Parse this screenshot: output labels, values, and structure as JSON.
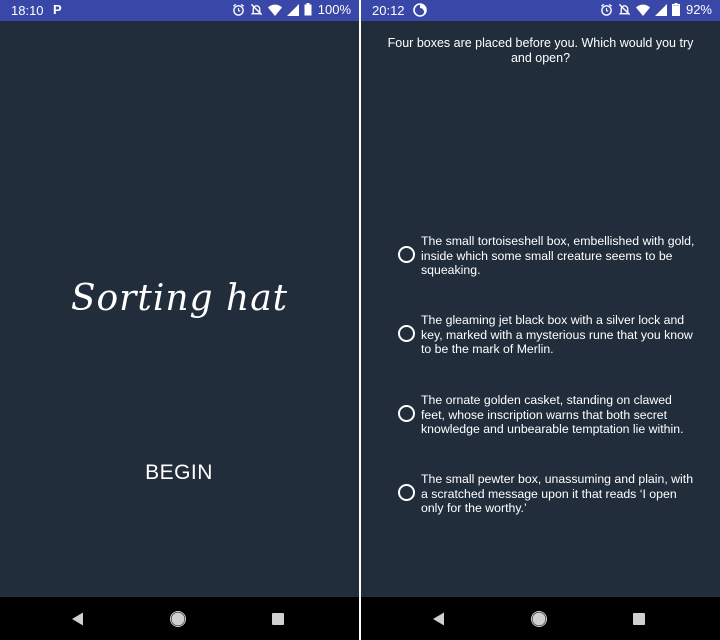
{
  "left_screen": {
    "status_bar": {
      "time": "18:10",
      "notification_icon": "parking-p-icon",
      "battery": "100%"
    },
    "title": "Sorting hat",
    "begin_label": "BEGIN"
  },
  "right_screen": {
    "status_bar": {
      "time": "20:12",
      "notification_icon": "circle-app-icon",
      "battery": "92%"
    },
    "question": "Four boxes are placed before you. Which would you try and open?",
    "options": [
      {
        "label": "The small tortoiseshell box, embellished with gold, inside which some small creature seems to be squeaking."
      },
      {
        "label": "The gleaming jet black box with a silver lock and key, marked with a mysterious rune that you know to be the mark of Merlin."
      },
      {
        "label": "The ornate golden casket, standing on clawed feet, whose inscription warns that both secret knowledge and unbearable temptation lie within."
      },
      {
        "label": "The small pewter box, unassuming and plain, with a scratched message upon it that reads ‘I open only for the worthy.’"
      }
    ]
  },
  "colors": {
    "status_bar": "#3948a8",
    "background": "#222d3c",
    "nav_bar": "#000000",
    "text": "#ffffff"
  }
}
